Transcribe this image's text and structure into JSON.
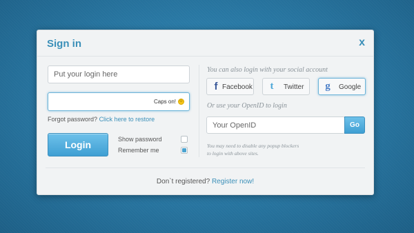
{
  "dialog": {
    "title": "Sign in",
    "close_label": "x"
  },
  "login": {
    "login_placeholder": "Put your login here",
    "password_value": "",
    "caps_warning": "Caps on!",
    "forgot_text": "Forgot password?",
    "forgot_link": "Click here to restore",
    "login_button": "Login",
    "show_password_label": "Show password",
    "show_password_checked": false,
    "remember_me_label": "Remember me",
    "remember_me_checked": true
  },
  "social": {
    "intro": "You can also login with your social account",
    "buttons": [
      {
        "label": "Facebook",
        "icon": "facebook-icon",
        "glyph": "f"
      },
      {
        "label": "Twitter",
        "icon": "twitter-icon",
        "glyph": "t"
      },
      {
        "label": "Google",
        "icon": "google-icon",
        "glyph": "g"
      }
    ],
    "openid_intro": "Or use your OpenID to login",
    "openid_placeholder": "Your OpenID",
    "go_button": "Go",
    "popup_note_line1": "You may need to disable any popup blockers",
    "popup_note_line2": "to login with above sites."
  },
  "footer": {
    "register_text": "Don`t registered?",
    "register_link": "Register now!"
  },
  "colors": {
    "accent": "#3a8fb8",
    "button_blue": "#4aa9da",
    "background": "#2a7aa6"
  }
}
